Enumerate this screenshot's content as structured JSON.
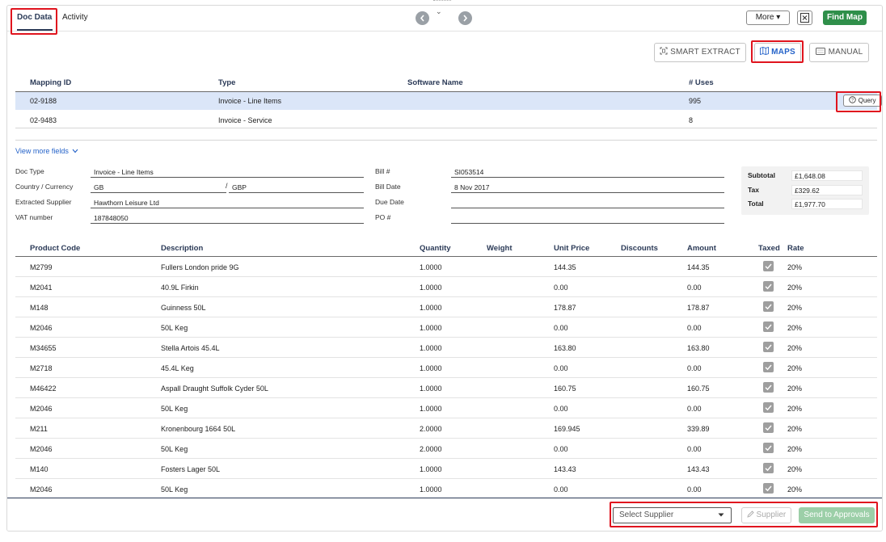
{
  "tabs": [
    {
      "label": "Doc Data"
    },
    {
      "label": "Activity"
    }
  ],
  "header": {
    "prev_icon": "chevron-left-icon",
    "next_icon": "chevron-right-icon",
    "collapse_glyph": "⌄",
    "more_label": "More",
    "more_caret": "▾",
    "find_map_label": "Find Map"
  },
  "modes": {
    "smart_extract_label": "SMART EXTRACT",
    "maps_label": "MAPS",
    "manual_label": "MANUAL"
  },
  "mapping_table": {
    "columns": [
      "Mapping ID",
      "Type",
      "Software Name",
      "# Uses"
    ],
    "rows": [
      {
        "id": "02-9188",
        "type": "Invoice - Line Items",
        "software": "",
        "uses": "995",
        "selected": true
      },
      {
        "id": "02-9483",
        "type": "Invoice - Service",
        "software": "",
        "uses": "8",
        "selected": false
      }
    ],
    "query_label": "Query"
  },
  "view_more_label": "View more fields",
  "doc_fields": {
    "doc_type_label": "Doc Type",
    "doc_type_value": "Invoice - Line Items",
    "country_currency_label": "Country / Currency",
    "country_value": "GB",
    "currency_value": "GBP",
    "extracted_supplier_label": "Extracted Supplier",
    "extracted_supplier_value": "Hawthorn Leisure Ltd",
    "vat_label": "VAT number",
    "vat_value": "187848050",
    "bill_no_label": "Bill #",
    "bill_no_value": "SI053514",
    "bill_date_label": "Bill Date",
    "bill_date_value": "8 Nov 2017",
    "due_date_label": "Due Date",
    "due_date_value": "",
    "po_label": "PO #",
    "po_value": ""
  },
  "totals": {
    "subtotal_label": "Subtotal",
    "subtotal_value": "£1,648.08",
    "tax_label": "Tax",
    "tax_value": "£329.62",
    "total_label": "Total",
    "total_value": "£1,977.70"
  },
  "products": {
    "columns": [
      "Product Code",
      "Description",
      "Quantity",
      "Weight",
      "Unit Price",
      "Discounts",
      "Amount",
      "Taxed",
      "Rate"
    ],
    "rows": [
      {
        "code": "M2799",
        "desc": "Fullers London pride 9G",
        "qty": "1.0000",
        "weight": "",
        "unit": "144.35",
        "disc": "",
        "amount": "144.35",
        "taxed": true,
        "rate": "20%"
      },
      {
        "code": "M2041",
        "desc": "40.9L Firkin",
        "qty": "1.0000",
        "weight": "",
        "unit": "0.00",
        "disc": "",
        "amount": "0.00",
        "taxed": true,
        "rate": "20%"
      },
      {
        "code": "M148",
        "desc": "Guinness 50L",
        "qty": "1.0000",
        "weight": "",
        "unit": "178.87",
        "disc": "",
        "amount": "178.87",
        "taxed": true,
        "rate": "20%"
      },
      {
        "code": "M2046",
        "desc": "50L Keg",
        "qty": "1.0000",
        "weight": "",
        "unit": "0.00",
        "disc": "",
        "amount": "0.00",
        "taxed": true,
        "rate": "20%"
      },
      {
        "code": "M34655",
        "desc": "Stella Artois 45.4L",
        "qty": "1.0000",
        "weight": "",
        "unit": "163.80",
        "disc": "",
        "amount": "163.80",
        "taxed": true,
        "rate": "20%"
      },
      {
        "code": "M2718",
        "desc": "45.4L Keg",
        "qty": "1.0000",
        "weight": "",
        "unit": "0.00",
        "disc": "",
        "amount": "0.00",
        "taxed": true,
        "rate": "20%"
      },
      {
        "code": "M46422",
        "desc": "Aspall Draught Suffolk Cyder 50L",
        "qty": "1.0000",
        "weight": "",
        "unit": "160.75",
        "disc": "",
        "amount": "160.75",
        "taxed": true,
        "rate": "20%"
      },
      {
        "code": "M2046",
        "desc": "50L Keg",
        "qty": "1.0000",
        "weight": "",
        "unit": "0.00",
        "disc": "",
        "amount": "0.00",
        "taxed": true,
        "rate": "20%"
      },
      {
        "code": "M211",
        "desc": "Kronenbourg 1664 50L",
        "qty": "2.0000",
        "weight": "",
        "unit": "169.945",
        "disc": "",
        "amount": "339.89",
        "taxed": true,
        "rate": "20%"
      },
      {
        "code": "M2046",
        "desc": "50L Keg",
        "qty": "2.0000",
        "weight": "",
        "unit": "0.00",
        "disc": "",
        "amount": "0.00",
        "taxed": true,
        "rate": "20%"
      },
      {
        "code": "M140",
        "desc": "Fosters Lager 50L",
        "qty": "1.0000",
        "weight": "",
        "unit": "143.43",
        "disc": "",
        "amount": "143.43",
        "taxed": true,
        "rate": "20%"
      },
      {
        "code": "M2046",
        "desc": "50L Keg",
        "qty": "1.0000",
        "weight": "",
        "unit": "0.00",
        "disc": "",
        "amount": "0.00",
        "taxed": true,
        "rate": "20%"
      }
    ]
  },
  "footer": {
    "select_placeholder": "Select Supplier",
    "supplier_label": "Supplier",
    "send_label": "Send to Approvals"
  },
  "colors": {
    "accent_blue": "#2563c9",
    "brand_green": "#2f8f4a",
    "highlight_red": "#e0141e",
    "selected_row": "#dbe6f8"
  }
}
